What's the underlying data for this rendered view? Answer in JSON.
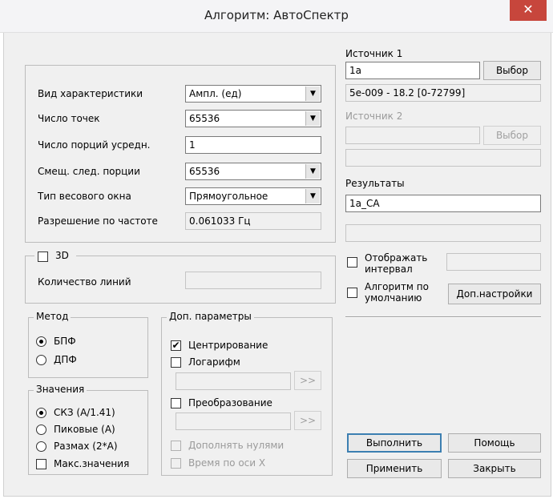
{
  "window": {
    "title": "Алгоритм: АвтоСпектр",
    "close_glyph": "✕"
  },
  "params": {
    "char_type_label": "Вид характеристики",
    "char_type_value": "Ампл. (ед)",
    "points_label": "Число точек",
    "points_value": "65536",
    "avg_label": "Число порций усредн.",
    "avg_value": "1",
    "offset_label": "Смещ. след. порции",
    "offset_value": "65536",
    "window_label": "Тип весового окна",
    "window_value": "Прямоугольное",
    "resolution_label": "Разрешение по частоте",
    "resolution_value": "0.061033 Гц"
  },
  "threed": {
    "label": "3D",
    "lines_label": "Количество линий",
    "lines_value": ""
  },
  "method": {
    "legend": "Метод",
    "fft": "БПФ",
    "dft": "ДПФ",
    "selected": "fft"
  },
  "values": {
    "legend": "Значения",
    "rms": "СКЗ (А/1.41)",
    "peak": "Пиковые (А)",
    "range": "Размах (2*А)",
    "max": "Макс.значения",
    "selected": "rms"
  },
  "extra": {
    "legend": "Доп. параметры",
    "centering": "Центрирование",
    "centering_checked": true,
    "log": "Логарифм",
    "log_btn": ">>",
    "transform": "Преобразование",
    "transform_btn": ">>",
    "zero_pad": "Дополнять нулями",
    "time_x": "Время по оси X"
  },
  "source1": {
    "label": "Источник 1",
    "value": "1a",
    "button": "Выбор",
    "info": "5e-009 - 18.2 [0-72799]"
  },
  "source2": {
    "label": "Источник 2",
    "value": "",
    "button": "Выбор",
    "info": ""
  },
  "results": {
    "label": "Результаты",
    "value": "1a_CA",
    "extra": ""
  },
  "options": {
    "show_interval": "Отображать интервал",
    "interval_value": "",
    "default_algo": "Алгоритм по умолчанию",
    "adv_settings": "Доп.настройки"
  },
  "buttons": {
    "run": "Выполнить",
    "help": "Помощь",
    "apply": "Применить",
    "close": "Закрыть"
  }
}
